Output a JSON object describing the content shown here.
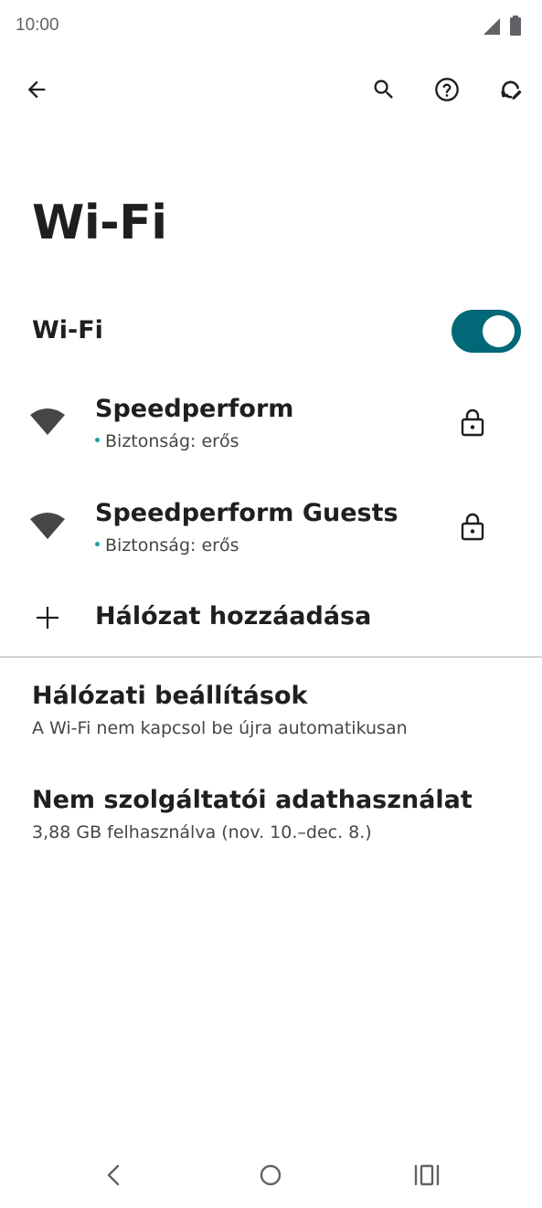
{
  "status_bar": {
    "time": "10:00",
    "icons": [
      "cell-signal-icon",
      "battery-icon"
    ]
  },
  "app_bar": {
    "icons": [
      "back-arrow-icon",
      "search-icon",
      "help-icon",
      "refresh-icon"
    ]
  },
  "page": {
    "title": "Wi-Fi"
  },
  "wifi_toggle": {
    "label": "Wi-Fi",
    "enabled": true,
    "accent_color": "#006876"
  },
  "networks": [
    {
      "name": "Speedperform",
      "security": "Biztonság: erős",
      "icon": "wifi-signal-icon",
      "secured": true
    },
    {
      "name": "Speedperform Guests",
      "security": "Biztonság: erős",
      "icon": "wifi-signal-icon",
      "secured": true
    }
  ],
  "add_network": {
    "label": "Hálózat hozzáadása",
    "icon": "plus-icon"
  },
  "preferences": [
    {
      "title": "Hálózati beállítások",
      "summary": "A Wi-Fi nem kapcsol be újra automatikusan"
    },
    {
      "title": "Nem szolgáltatói adathasználat",
      "summary": "3,88 GB felhasználva (nov. 10.–dec. 8.)"
    }
  ],
  "nav_bar": {
    "icons": [
      "nav-back-icon",
      "nav-home-icon",
      "nav-recents-icon"
    ]
  },
  "colors": {
    "accent": "#006876",
    "security_dot": "#17a39c",
    "text_primary": "#1f1f1f",
    "text_secondary": "#444746"
  }
}
